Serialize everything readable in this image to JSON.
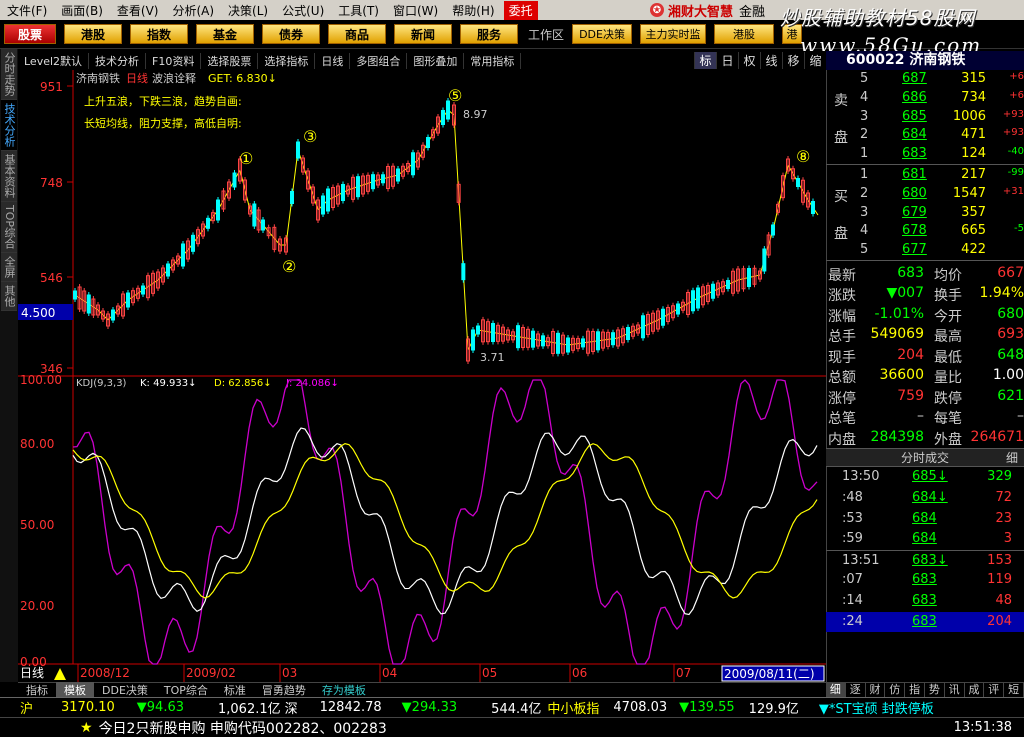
{
  "menu": [
    "文件(F)",
    "画面(B)",
    "查看(V)",
    "分析(A)",
    "决策(L)",
    "公式(U)",
    "工具(T)",
    "窗口(W)",
    "帮助(H)",
    "委托"
  ],
  "brand": {
    "name": "湘财大智慧",
    "suffix": "金融"
  },
  "watermark": {
    "line1": "炒股辅助教材58股网",
    "line2": "www.58Gu.com"
  },
  "buttons": {
    "first": "股票",
    "list": [
      "港股",
      "指数",
      "基金",
      "债券",
      "商品",
      "新闻",
      "服务"
    ],
    "workspace": "工作区",
    "dde": "DDE决策",
    "main_monitor": "主力实时监",
    "hk": "港股",
    "more": "港"
  },
  "side_tabs": [
    "分时走势",
    "技术分析",
    "基本资料",
    "TOP综合",
    "全屏",
    "其他"
  ],
  "toolbar": {
    "items": [
      "Level2默认",
      "技术分析",
      "F10资料",
      "选择股票",
      "选择指标",
      "日线",
      "多图组合",
      "图形叠加",
      "常用指标"
    ],
    "right": [
      "标",
      "日",
      "权",
      "线",
      "移",
      "缩"
    ]
  },
  "chart_header": {
    "stock": "济南钢铁",
    "period": "日线",
    "indicator": "波浪诠释",
    "get": "GET: 6.830↓"
  },
  "annotations": {
    "line1": "上升五浪，下跌三浪，趋势自画:",
    "line2": "长短均线，阻力支撑，高低自明:"
  },
  "price_axis": {
    "ticks": [
      "951",
      "748",
      "546",
      "346"
    ],
    "current": "4.500"
  },
  "price_marks": {
    "high": "8.97",
    "low": "3.71"
  },
  "kdj": {
    "header": "KDJ(9,3,3)",
    "k": "K: 49.933↓",
    "d": "D: 62.856↓",
    "j": "J: 24.086↓",
    "ticks": [
      "100.00",
      "80.00",
      "50.00",
      "20.00",
      "0.00"
    ]
  },
  "date_axis": {
    "period_label": "日线",
    "labels": [
      "2008/12",
      "2009/02",
      "03",
      "04",
      "05",
      "06",
      "07"
    ],
    "end": "2009/08/11(二)"
  },
  "chart_tabs": [
    "指标",
    "模板",
    "DDE决策",
    "TOP综合",
    "标准",
    "冒勇趋势",
    "存为模板"
  ],
  "stock_header": "600022 济南钢铁",
  "order_book": {
    "sell_label": "卖盘",
    "buy_label": "买盘",
    "sells": [
      {
        "lvl": "5",
        "price": "687",
        "vol": "315",
        "chg": "+6"
      },
      {
        "lvl": "4",
        "price": "686",
        "vol": "734",
        "chg": "+6"
      },
      {
        "lvl": "3",
        "price": "685",
        "vol": "1006",
        "chg": "+93"
      },
      {
        "lvl": "2",
        "price": "684",
        "vol": "471",
        "chg": "+93"
      },
      {
        "lvl": "1",
        "price": "683",
        "vol": "124",
        "chg": "-40"
      }
    ],
    "buys": [
      {
        "lvl": "1",
        "price": "681",
        "vol": "217",
        "chg": "-99"
      },
      {
        "lvl": "2",
        "price": "680",
        "vol": "1547",
        "chg": "+31"
      },
      {
        "lvl": "3",
        "price": "679",
        "vol": "357",
        "chg": ""
      },
      {
        "lvl": "4",
        "price": "678",
        "vol": "665",
        "chg": "-5"
      },
      {
        "lvl": "5",
        "price": "677",
        "vol": "422",
        "chg": ""
      }
    ]
  },
  "stats": [
    {
      "l1": "最新",
      "v1": "683",
      "c1": "green",
      "l2": "均价",
      "v2": "667",
      "c2": "red"
    },
    {
      "l1": "涨跌",
      "v1": "▼007",
      "c1": "green",
      "l2": "换手",
      "v2": "1.94%",
      "c2": "yellow"
    },
    {
      "l1": "涨幅",
      "v1": "-1.01%",
      "c1": "green",
      "l2": "今开",
      "v2": "680",
      "c2": "green"
    },
    {
      "l1": "总手",
      "v1": "549069",
      "c1": "yellow",
      "l2": "最高",
      "v2": "693",
      "c2": "red"
    },
    {
      "l1": "现手",
      "v1": "204",
      "c1": "red",
      "l2": "最低",
      "v2": "648",
      "c2": "green"
    },
    {
      "l1": "总额",
      "v1": "36600",
      "c1": "yellow",
      "l2": "量比",
      "v2": "1.00",
      "c2": "white"
    },
    {
      "l1": "涨停",
      "v1": "759",
      "c1": "red",
      "l2": "跌停",
      "v2": "621",
      "c2": "green"
    },
    {
      "l1": "总笔",
      "v1": "–",
      "c1": "gray",
      "l2": "每笔",
      "v2": "–",
      "c2": "gray"
    },
    {
      "l1": "内盘",
      "v1": "284398",
      "c1": "green",
      "l2": "外盘",
      "v2": "264671",
      "c2": "red"
    }
  ],
  "trades_header": "分时成交",
  "trades_detail": "细",
  "trades": [
    {
      "t": "13:50",
      "p": "685↓",
      "v": "329",
      "pc": "green",
      "vc": "green"
    },
    {
      "t": ":48",
      "p": "684↓",
      "v": "72",
      "pc": "green",
      "vc": "red"
    },
    {
      "t": ":53",
      "p": "684",
      "v": "23",
      "pc": "green",
      "vc": "red"
    },
    {
      "t": ":59",
      "p": "684",
      "v": "3",
      "pc": "green",
      "vc": "red"
    },
    {
      "t": "13:51",
      "p": "683↓",
      "v": "153",
      "pc": "green",
      "vc": "red"
    },
    {
      "t": ":07",
      "p": "683",
      "v": "119",
      "pc": "green",
      "vc": "red"
    },
    {
      "t": ":14",
      "p": "683",
      "v": "48",
      "pc": "green",
      "vc": "red"
    },
    {
      "t": ":24",
      "p": "683",
      "v": "204",
      "pc": "green",
      "vc": "red"
    }
  ],
  "bottom_tabs": [
    "细",
    "逐",
    "财",
    "仿",
    "指",
    "势",
    "讯",
    "成",
    "评",
    "短"
  ],
  "status1": {
    "sh_label": "沪",
    "sh_val": "3170.10",
    "sh_chg": "▼94.63",
    "sh_amt": "1,062.1亿",
    "sz_label": "深",
    "sz_val": "12842.78",
    "sz_chg": "▼294.33",
    "sz_amt": "544.4亿",
    "zxb": "中小板指",
    "zxb_val": "4708.03",
    "zxb_chg": "▼139.55",
    "zxb_amt": "129.9亿",
    "st": "▼*ST宝硕 封跌停板"
  },
  "status2": {
    "news": "今日2只新股申购 申购代码002282、002283",
    "time": "13:51:38"
  }
}
